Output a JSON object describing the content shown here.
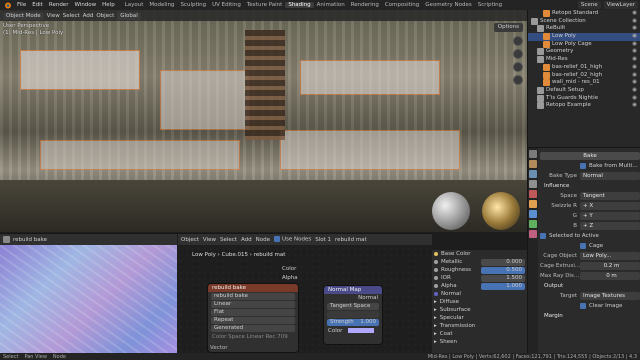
{
  "topbar": {
    "menus": [
      "File",
      "Edit",
      "Render",
      "Window",
      "Help"
    ],
    "workspaces": [
      "Layout",
      "Modeling",
      "Sculpting",
      "UV Editing",
      "Texture Paint",
      "Shading",
      "Animation",
      "Rendering",
      "Compositing",
      "Geometry Nodes",
      "Scripting"
    ],
    "active_workspace": "Shading",
    "scene": "Scene",
    "view_layer": "ViewLayer"
  },
  "viewport": {
    "mode": "Object Mode",
    "menus": [
      "View",
      "Select",
      "Add",
      "Object"
    ],
    "orientation": "Global",
    "info_line1": "User Perspective",
    "info_line2": "(1) Mid-Res | Low Poly",
    "options": "Options"
  },
  "outliner": {
    "rows": [
      {
        "label": "Retopo Standard",
        "indent": 2,
        "sel": false
      },
      {
        "label": "Scene Collection",
        "indent": 0,
        "sel": false
      },
      {
        "label": "ReBuilt",
        "indent": 1,
        "sel": false
      },
      {
        "label": "Low Poly",
        "indent": 2,
        "sel": true
      },
      {
        "label": "Low Poly Cage",
        "indent": 2,
        "sel": false
      },
      {
        "label": "Geometry",
        "indent": 1,
        "sel": false
      },
      {
        "label": "Mid-Res",
        "indent": 1,
        "sel": false
      },
      {
        "label": "bas-relief_01_high",
        "indent": 2,
        "sel": false
      },
      {
        "label": "bas-relief_02_high",
        "indent": 2,
        "sel": false
      },
      {
        "label": "wall_mid - res_01",
        "indent": 2,
        "sel": false
      },
      {
        "label": "Default Setup",
        "indent": 1,
        "sel": false
      },
      {
        "label": "T'is Guards Nightie",
        "indent": 1,
        "sel": false
      },
      {
        "label": "Retopo Example",
        "indent": 1,
        "sel": false
      }
    ]
  },
  "props": {
    "bake_button": "Bake",
    "bake_from_multires": "Bake from Multi...",
    "bake_type_label": "Bake Type",
    "bake_type": "Normal",
    "influence": "Influence",
    "space_label": "Space",
    "space": "Tangent",
    "swizzle_label": "Swizzle R",
    "swizzle_r": "+ X",
    "swizzle_g_label": "G",
    "swizzle_g": "+ Y",
    "swizzle_b_label": "B",
    "swizzle_b": "+ Z",
    "selected_to_active": "Selected to Active",
    "cage": "Cage",
    "cage_object_label": "Cage Object",
    "cage_object": "Low Poly...",
    "cage_extrusion_label": "Cage Extrusi...",
    "cage_extrusion": "0.2 m",
    "max_ray_label": "Max Ray Dis...",
    "max_ray": "0 m",
    "output": "Output",
    "target_label": "Target",
    "target": "Image Textures",
    "clear_image": "Clear Image",
    "margin": "Margin"
  },
  "uv": {
    "image_name": "rebuild bake"
  },
  "nodes": {
    "editor_type": "Object",
    "menus": [
      "View",
      "Select",
      "Add",
      "Node"
    ],
    "use_nodes": "Use Nodes",
    "slot": "Slot 1",
    "material": "rebuild mat",
    "crumb": [
      "Low Poly",
      "Cube.015",
      "rebuild mat"
    ],
    "image_node": {
      "title": "rebuild bake",
      "image_name": "rebuild bake",
      "interpolation": "Linear",
      "projection": "Flat",
      "extension": "Repeat",
      "source": "Generated",
      "color_space_label": "Color Space",
      "color_space": "Linear Rec.709",
      "vector": "Vector",
      "out_color": "Color",
      "out_alpha": "Alpha"
    },
    "normal_node": {
      "title": "Normal Map",
      "out_normal": "Normal",
      "space": "Tangent Space",
      "strength_label": "Strength",
      "strength": "1.000",
      "in_color": "Color"
    }
  },
  "material_panel": {
    "rows": [
      {
        "label": "Base Color",
        "value": "",
        "color": "#e0c060"
      },
      {
        "label": "Metallic",
        "value": "0.000",
        "color": "#a0a0a0"
      },
      {
        "label": "Roughness",
        "value": "0.500",
        "color": "#a0a0a0",
        "blue": true
      },
      {
        "label": "IOR",
        "value": "1.500",
        "color": "#a0a0a0"
      },
      {
        "label": "Alpha",
        "value": "1.000",
        "color": "#a0a0a0",
        "blue": true
      },
      {
        "label": "Normal",
        "value": "",
        "color": "#6363c7"
      }
    ],
    "subpanels": [
      "Diffuse",
      "Subsurface",
      "Specular",
      "Transmission",
      "Coat",
      "Sheen"
    ]
  },
  "status": {
    "select": "Select",
    "pan": "Pan View",
    "node": "Node",
    "stats": "Mid-Res | Low Poly | Verts:62,602 | Faces:121,791 | Tris:124,555 | Objects:2/13 | 4.3"
  }
}
